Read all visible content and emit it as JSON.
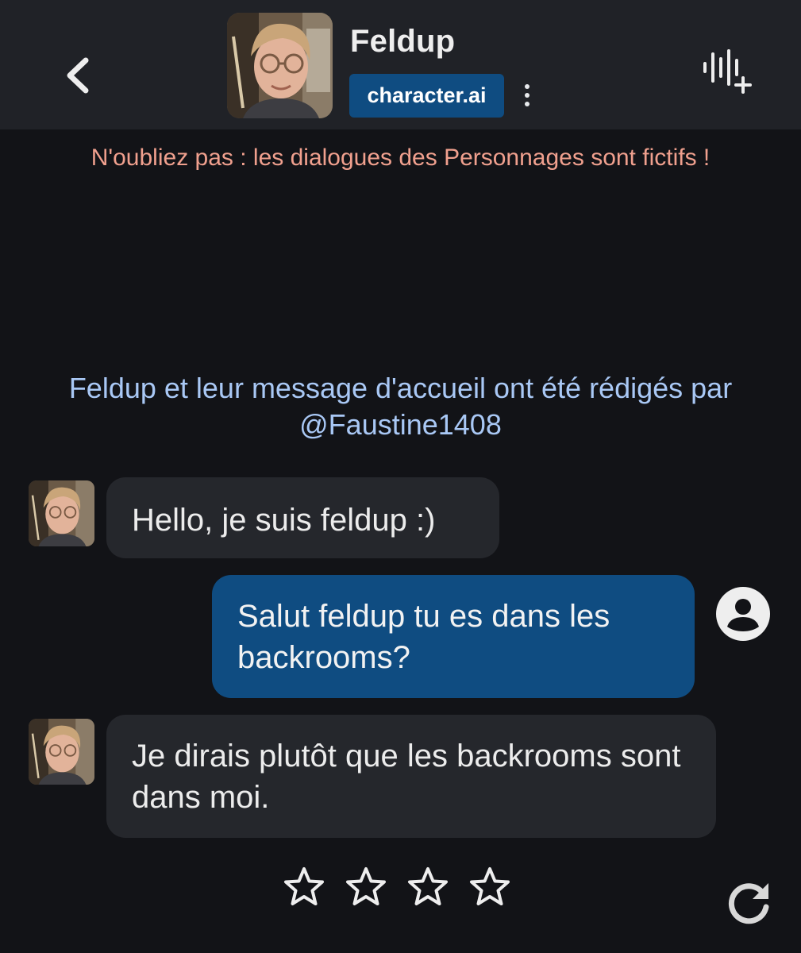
{
  "header": {
    "character_name": "Feldup",
    "brand": "character.ai"
  },
  "disclaimer": "N'oubliez pas : les dialogues des Personnages sont fictifs !",
  "creator_note": {
    "line1": "Feldup et leur message d'accueil ont été rédigés par",
    "line2": "@Faustine1408"
  },
  "messages": [
    {
      "sender": "bot",
      "text": "Hello, je suis feldup :)"
    },
    {
      "sender": "user",
      "text": "Salut feldup tu es dans les backrooms?"
    },
    {
      "sender": "bot",
      "text": "Je dirais plutôt que les backrooms sont dans moi."
    }
  ],
  "rating": {
    "stars_total": 4,
    "stars_selected": 0
  },
  "icons": {
    "back": "chevron-left-icon",
    "more": "more-vertical-icon",
    "voice": "voice-add-icon",
    "user": "user-circle-icon",
    "star": "star-outline-icon",
    "regenerate": "refresh-icon"
  },
  "colors": {
    "background": "#121317",
    "header": "#202227",
    "accent": "#0f4c81",
    "bot_bubble": "#25272c",
    "disclaimer": "#f0a08e",
    "creator_note": "#a9c8f5"
  }
}
